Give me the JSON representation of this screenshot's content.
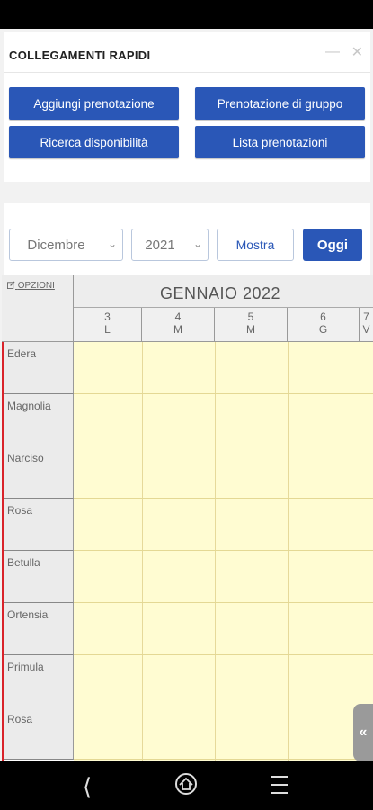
{
  "quick_links": {
    "title": "COLLEGAMENTI RAPIDI",
    "minimize_glyph": "—",
    "close_glyph": "✕",
    "buttons": [
      {
        "label": "Aggiungi prenotazione"
      },
      {
        "label": "Prenotazione di gruppo"
      },
      {
        "label": "Ricerca disponibilità"
      },
      {
        "label": "Lista prenotazioni"
      }
    ]
  },
  "controls": {
    "month": "Dicembre",
    "year": "2021",
    "show_label": "Mostra",
    "today_label": "Oggi"
  },
  "calendar": {
    "options_label": "OPZIONI",
    "month_title": "GENNAIO 2022",
    "days": [
      {
        "num": "3",
        "dow": "L"
      },
      {
        "num": "4",
        "dow": "M"
      },
      {
        "num": "5",
        "dow": "M"
      },
      {
        "num": "6",
        "dow": "G"
      },
      {
        "num": "7",
        "dow": "V"
      }
    ],
    "rooms": [
      "Edera",
      "Magnolia",
      "Narciso",
      "Rosa",
      "Betulla",
      "Ortensia",
      "Primula",
      "Rosa"
    ]
  },
  "side_tab_glyph": "«",
  "colors": {
    "primary": "#2a57b7",
    "cell_bg": "#fffcd2",
    "accent_red": "#d9232a"
  },
  "icons": {
    "nav_back": "back-icon",
    "nav_home": "home-icon",
    "nav_recent": "recent-apps-icon",
    "options": "edit-icon"
  }
}
